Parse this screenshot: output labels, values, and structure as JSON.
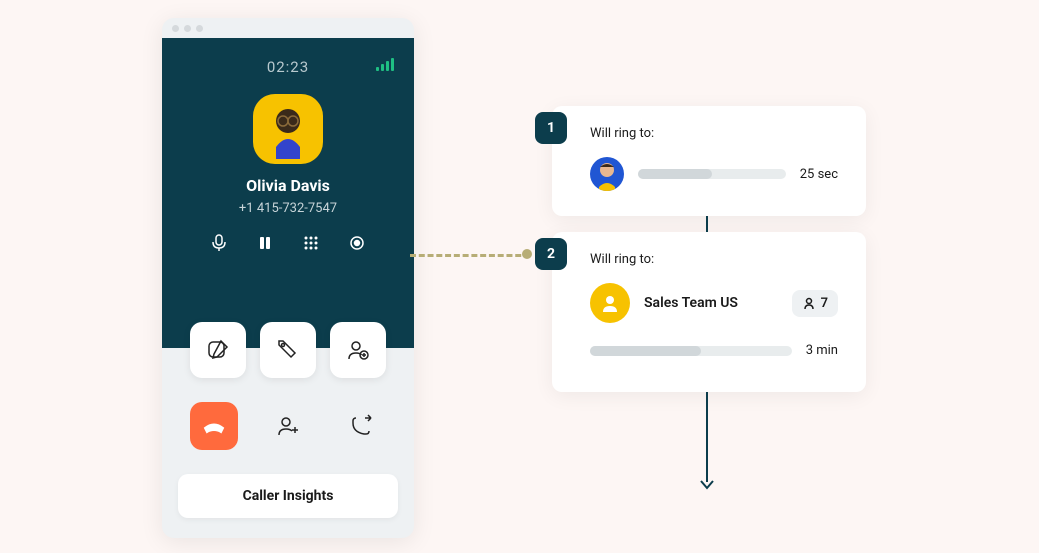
{
  "call": {
    "duration": "02:23",
    "caller_name": "Olivia Davis",
    "caller_phone": "+1 415-732-7547"
  },
  "insights_button": "Caller Insights",
  "flow": {
    "step1": {
      "badge": "1",
      "label": "Will ring to:",
      "duration": "25 sec"
    },
    "step2": {
      "badge": "2",
      "label": "Will ring to:",
      "team_name": "Sales Team US",
      "member_count": "7",
      "duration": "3 min"
    }
  }
}
